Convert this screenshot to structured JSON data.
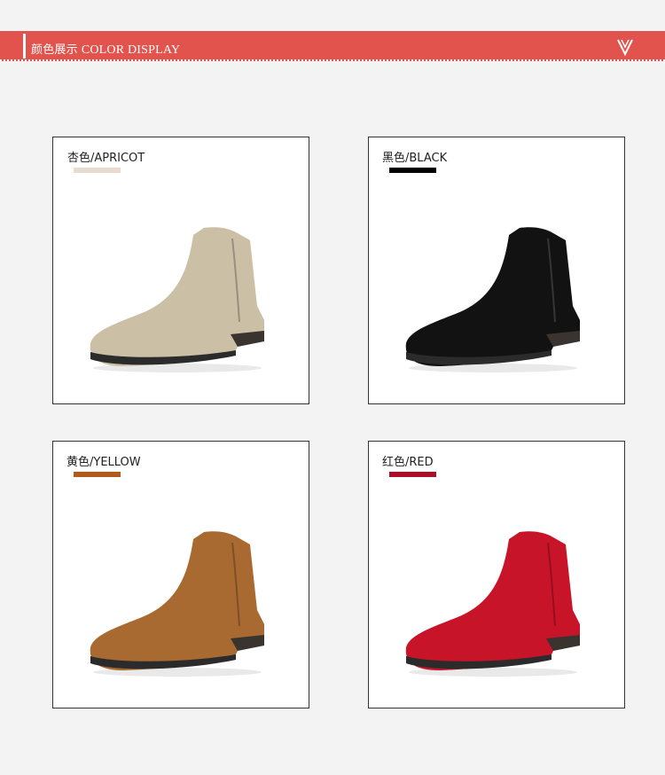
{
  "header": {
    "title_cn": "颜色展示",
    "title_en": "COLOR DISPLAY",
    "accent": "#e3534d"
  },
  "colors": [
    {
      "label": "杏色/APRICOT",
      "swatch": "#e8dcd0",
      "boot": "#cbbfa6"
    },
    {
      "label": "黑色/BLACK",
      "swatch": "#000000",
      "boot": "#121212"
    },
    {
      "label": "黄色/YELLOW",
      "swatch": "#b05a1c",
      "boot": "#a96a32"
    },
    {
      "label": "红色/RED",
      "swatch": "#a8102a",
      "boot": "#c81428"
    }
  ]
}
